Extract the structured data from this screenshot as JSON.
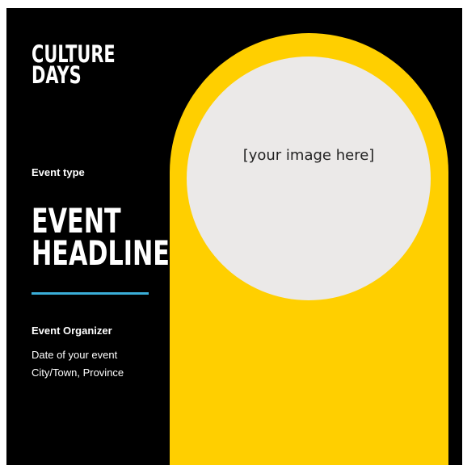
{
  "colors": {
    "background": "#000000",
    "arch": "#ffcf00",
    "image_placeholder": "#ebe9e8",
    "divider": "#3aaed8",
    "text": "#ffffff"
  },
  "logo": {
    "line1": "CULTURE",
    "line2": "DAYS"
  },
  "event_type": "Event type",
  "headline": {
    "line1": "EVENT",
    "line2": "HEADLINE"
  },
  "organizer": "Event Organizer",
  "date": "Date of your event",
  "location": "City/Town, Province",
  "image_placeholder": "[your image here]"
}
